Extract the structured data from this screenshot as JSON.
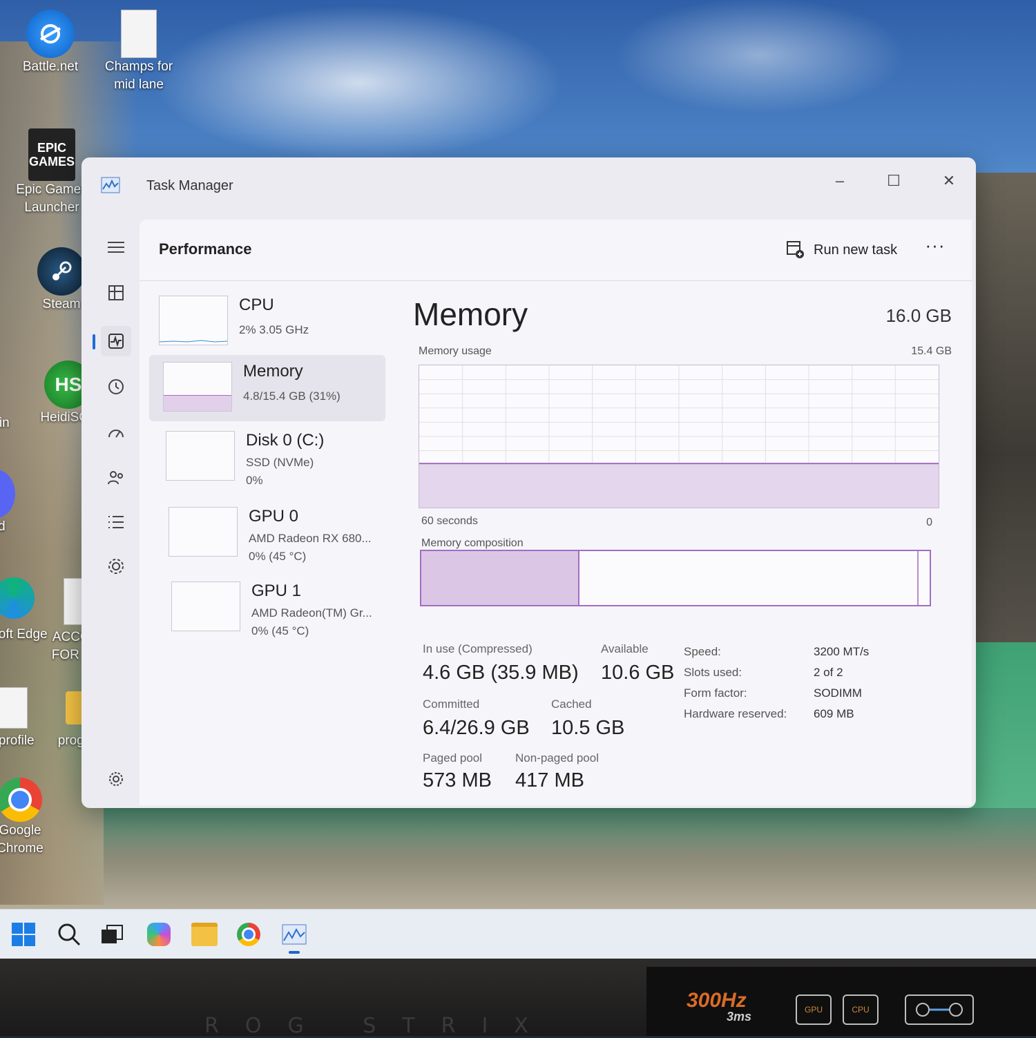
{
  "desktop": {
    "icons": [
      {
        "label": "Battle.net",
        "icon": "battlenet-icon"
      },
      {
        "label": "Champs for mid lane",
        "icon": "document-icon"
      },
      {
        "label": "Epic Games Launcher",
        "icon": "epic-games-icon",
        "logo_text": "EPIC GAMES"
      },
      {
        "label": "Steam",
        "icon": "steam-icon"
      },
      {
        "label": "HeidiSQL",
        "icon": "heidisql-icon",
        "logo_text": "HS"
      },
      {
        "label": "Bin",
        "icon": "recycle-bin-icon"
      },
      {
        "label": "ord",
        "icon": "discord-icon"
      },
      {
        "label": "rosoft Edge",
        "icon": "edge-icon"
      },
      {
        "label": "ACCOUN FOR NEP",
        "icon": "document-icon"
      },
      {
        "label": "l profile",
        "icon": "document-icon"
      },
      {
        "label": "programm",
        "icon": "folder-icon"
      },
      {
        "label": "Google Chrome",
        "icon": "chrome-icon"
      }
    ]
  },
  "window": {
    "title": "Task Manager",
    "controls": {
      "minimize": "–",
      "maximize": "☐",
      "close": "✕"
    }
  },
  "nav": {
    "items": [
      {
        "name": "hamburger-menu-icon",
        "active": false
      },
      {
        "name": "processes-icon",
        "active": false
      },
      {
        "name": "performance-icon",
        "active": true
      },
      {
        "name": "app-history-icon",
        "active": false
      },
      {
        "name": "startup-apps-icon",
        "active": false
      },
      {
        "name": "users-icon",
        "active": false
      },
      {
        "name": "details-icon",
        "active": false
      },
      {
        "name": "services-icon",
        "active": false
      },
      {
        "name": "settings-icon",
        "active": false
      }
    ]
  },
  "header": {
    "title": "Performance",
    "run_new_task": "Run new task",
    "more": "···"
  },
  "perf_list": [
    {
      "name": "CPU",
      "line1": "2%  3.05 GHz",
      "line2": "",
      "selected": false
    },
    {
      "name": "Memory",
      "line1": "4.8/15.4 GB (31%)",
      "line2": "",
      "selected": true
    },
    {
      "name": "Disk 0 (C:)",
      "line1": "SSD (NVMe)",
      "line2": "0%",
      "selected": false
    },
    {
      "name": "GPU 0",
      "line1": "AMD Radeon RX 680...",
      "line2": "0%  (45 °C)",
      "selected": false
    },
    {
      "name": "GPU 1",
      "line1": "AMD Radeon(TM) Gr...",
      "line2": "0%  (45 °C)",
      "selected": false
    }
  ],
  "memory": {
    "title": "Memory",
    "total": "16.0 GB",
    "usage_label": "Memory usage",
    "usage_max": "15.4 GB",
    "time_left": "60 seconds",
    "time_right": "0",
    "composition_label": "Memory composition",
    "usage_fraction": 0.31,
    "stats": {
      "in_use_label": "In use (Compressed)",
      "in_use_value": "4.6 GB (35.9 MB)",
      "available_label": "Available",
      "available_value": "10.6 GB",
      "committed_label": "Committed",
      "committed_value": "6.4/26.9 GB",
      "cached_label": "Cached",
      "cached_value": "10.5 GB",
      "paged_pool_label": "Paged pool",
      "paged_pool_value": "573 MB",
      "non_paged_pool_label": "Non-paged pool",
      "non_paged_pool_value": "417 MB"
    },
    "specs": {
      "speed_label": "Speed:",
      "speed_value": "3200 MT/s",
      "slots_label": "Slots used:",
      "slots_value": "2 of 2",
      "form_label": "Form factor:",
      "form_value": "SODIMM",
      "reserved_label": "Hardware reserved:",
      "reserved_value": "609 MB"
    }
  },
  "taskbar": {
    "icons": [
      "windows-start-icon",
      "search-icon",
      "task-view-icon",
      "copilot-icon",
      "file-explorer-icon",
      "chrome-icon",
      "task-manager-icon"
    ]
  },
  "bezel": {
    "brand": "ROG STRIX",
    "refresh": "300Hz",
    "response": "3ms",
    "sticker_gpu": "GPU",
    "sticker_cpu": "CPU"
  },
  "colors": {
    "accent": "#1f6bd6",
    "memory_purple": "#a36cc2",
    "window_bg": "#ecebf2"
  }
}
